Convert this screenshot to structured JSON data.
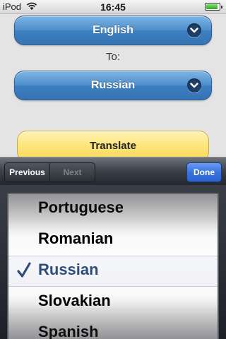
{
  "status_bar": {
    "carrier": "iPod",
    "time": "16:45",
    "battery_level": 0.9
  },
  "translator": {
    "source_language": "English",
    "to_label": "To:",
    "target_language": "Russian",
    "translate_label": "Translate"
  },
  "keyboard_toolbar": {
    "previous_label": "Previous",
    "next_label": "Next",
    "done_label": "Done"
  },
  "picker": {
    "options": [
      "Portuguese",
      "Romanian",
      "Russian",
      "Slovakian",
      "Spanish"
    ],
    "selected": "Russian"
  },
  "colors": {
    "select_blue": "#4e8fcd",
    "translate_yellow": "#fde47a",
    "done_blue": "#3a73e0",
    "selected_text": "#2f4d7b"
  },
  "icons": {
    "wifi": "wifi-icon",
    "battery": "battery-icon",
    "dropdown": "chevron-down-icon",
    "checkmark": "checkmark-icon"
  }
}
